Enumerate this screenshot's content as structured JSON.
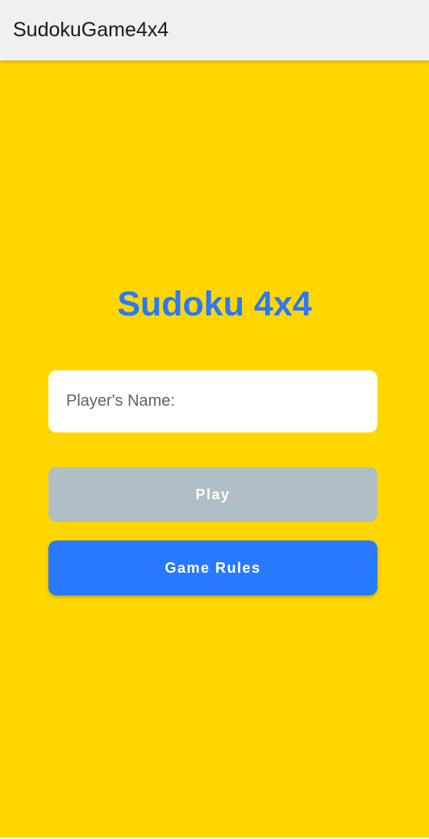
{
  "app_bar": {
    "title": "SudokuGame4x4"
  },
  "main": {
    "heading": "Sudoku 4x4",
    "name_input": {
      "placeholder": "Player's Name:",
      "value": ""
    },
    "play_button": {
      "label": "Play",
      "enabled": false
    },
    "rules_button": {
      "label": "Game Rules"
    }
  },
  "colors": {
    "background": "#ffd600",
    "app_bar": "#f0f0f2",
    "accent": "#2979ff",
    "disabled_button": "#b0bec5",
    "input_background": "#ffffff"
  }
}
